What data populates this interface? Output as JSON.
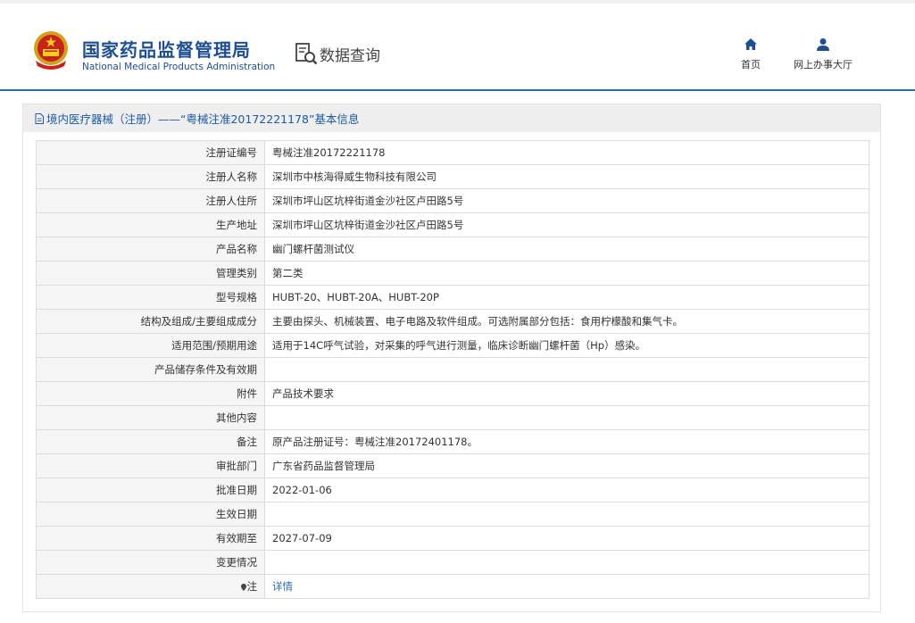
{
  "header": {
    "brand_cn": "国家药品监督管理局",
    "brand_en": "National Medical Products Administration",
    "module": "数据查询",
    "nav": {
      "home": "首页",
      "hall": "网上办事大厅"
    }
  },
  "panel": {
    "title": "境内医疗器械（注册）——“粤械注准20172221178”基本信息"
  },
  "rows": [
    {
      "label": "注册证编号",
      "value": "粤械注准20172221178"
    },
    {
      "label": "注册人名称",
      "value": "深圳市中核海得威生物科技有限公司"
    },
    {
      "label": "注册人住所",
      "value": "深圳市坪山区坑梓街道金沙社区卢田路5号"
    },
    {
      "label": "生产地址",
      "value": "深圳市坪山区坑梓街道金沙社区卢田路5号"
    },
    {
      "label": "产品名称",
      "value": "幽门螺杆菌测试仪"
    },
    {
      "label": "管理类别",
      "value": "第二类"
    },
    {
      "label": "型号规格",
      "value": "HUBT-20、HUBT-20A、HUBT-20P"
    },
    {
      "label": "结构及组成/主要组成成分",
      "value": "主要由探头、机械装置、电子电路及软件组成。可选附属部分包括：食用柠檬酸和集气卡。"
    },
    {
      "label": "适用范围/预期用途",
      "value": "适用于14C呼气试验，对采集的呼气进行测量，临床诊断幽门螺杆菌（Hp）感染。"
    },
    {
      "label": "产品储存条件及有效期",
      "value": ""
    },
    {
      "label": "附件",
      "value": "产品技术要求"
    },
    {
      "label": "其他内容",
      "value": ""
    },
    {
      "label": "备注",
      "value": "原产品注册证号：粤械注准20172401178。"
    },
    {
      "label": "审批部门",
      "value": "广东省药品监督管理局"
    },
    {
      "label": "批准日期",
      "value": "2022-01-06"
    },
    {
      "label": "生效日期",
      "value": ""
    },
    {
      "label": "有效期至",
      "value": "2027-07-09"
    },
    {
      "label": "变更情况",
      "value": ""
    }
  ],
  "note_row": {
    "label": "注",
    "link": "详情"
  },
  "colors": {
    "brand": "#1c4e96",
    "link": "#2b6cb0",
    "label_bg": "#f5f5f5"
  }
}
